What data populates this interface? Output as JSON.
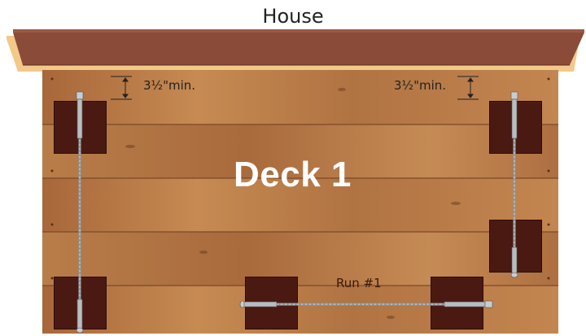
{
  "diagram": {
    "house_label": "House",
    "deck_title": "Deck 1",
    "clearance_left": "3½\"min.",
    "clearance_right": "3½\"min.",
    "run_label": "Run #1"
  },
  "colors": {
    "roof": "#8a4b38",
    "roof_trim": "#f3c98a",
    "deck_wood": "#b77a45",
    "post": "#4a1a12",
    "cable": "#9aa0a6",
    "title": "#ffffff"
  }
}
